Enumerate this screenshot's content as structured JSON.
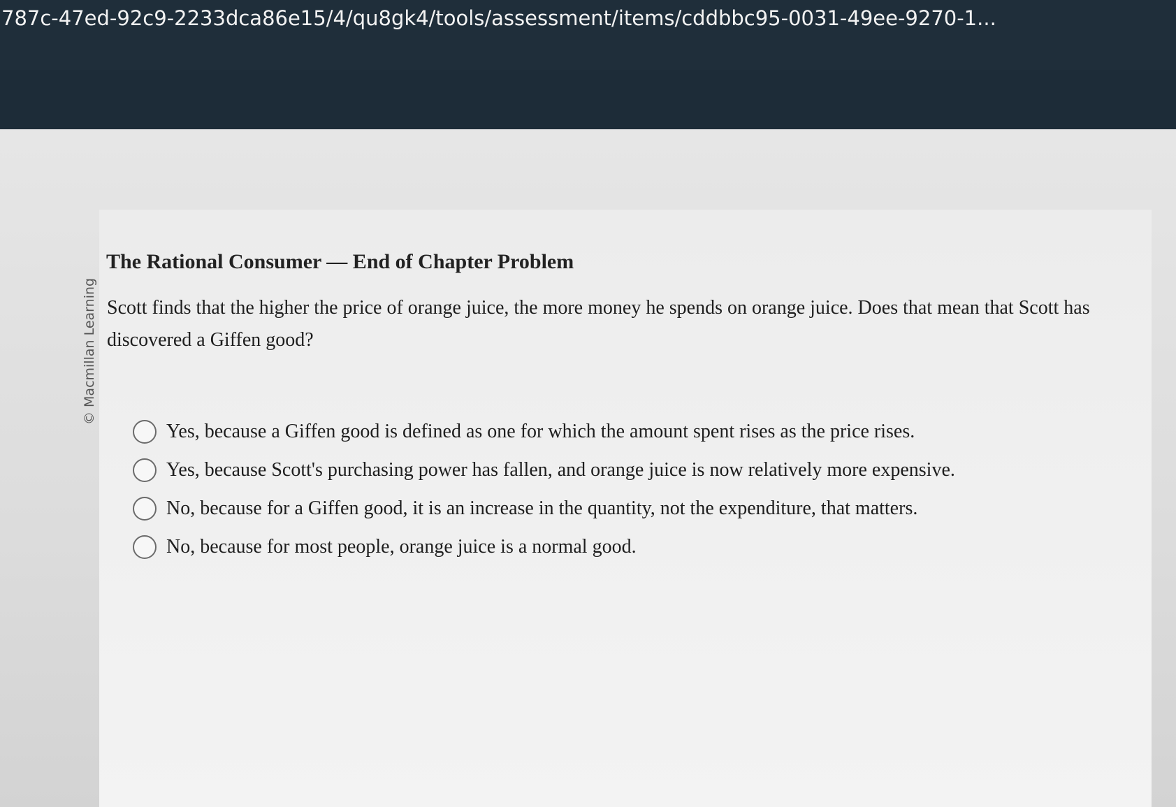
{
  "browser": {
    "url": "787c-47ed-92c9-2233dca86e15/4/qu8gk4/tools/assessment/items/cddbbc95-0031-49ee-9270-1..."
  },
  "credit": "© Macmillan Learning",
  "question": {
    "title": "The Rational Consumer — End of Chapter Problem",
    "text": "Scott finds that the higher the price of orange juice, the more money he spends on orange juice. Does that mean that Scott has discovered a Giffen good?"
  },
  "options": [
    {
      "label": "Yes, because a Giffen good is defined as one for which the amount spent rises as the price rises."
    },
    {
      "label": "Yes, because Scott's purchasing power has fallen, and orange juice is now relatively more expensive."
    },
    {
      "label": "No, because for a Giffen good, it is an increase in the quantity, not the expenditure, that matters."
    },
    {
      "label": "No, because for most people, orange juice is a normal good."
    }
  ]
}
